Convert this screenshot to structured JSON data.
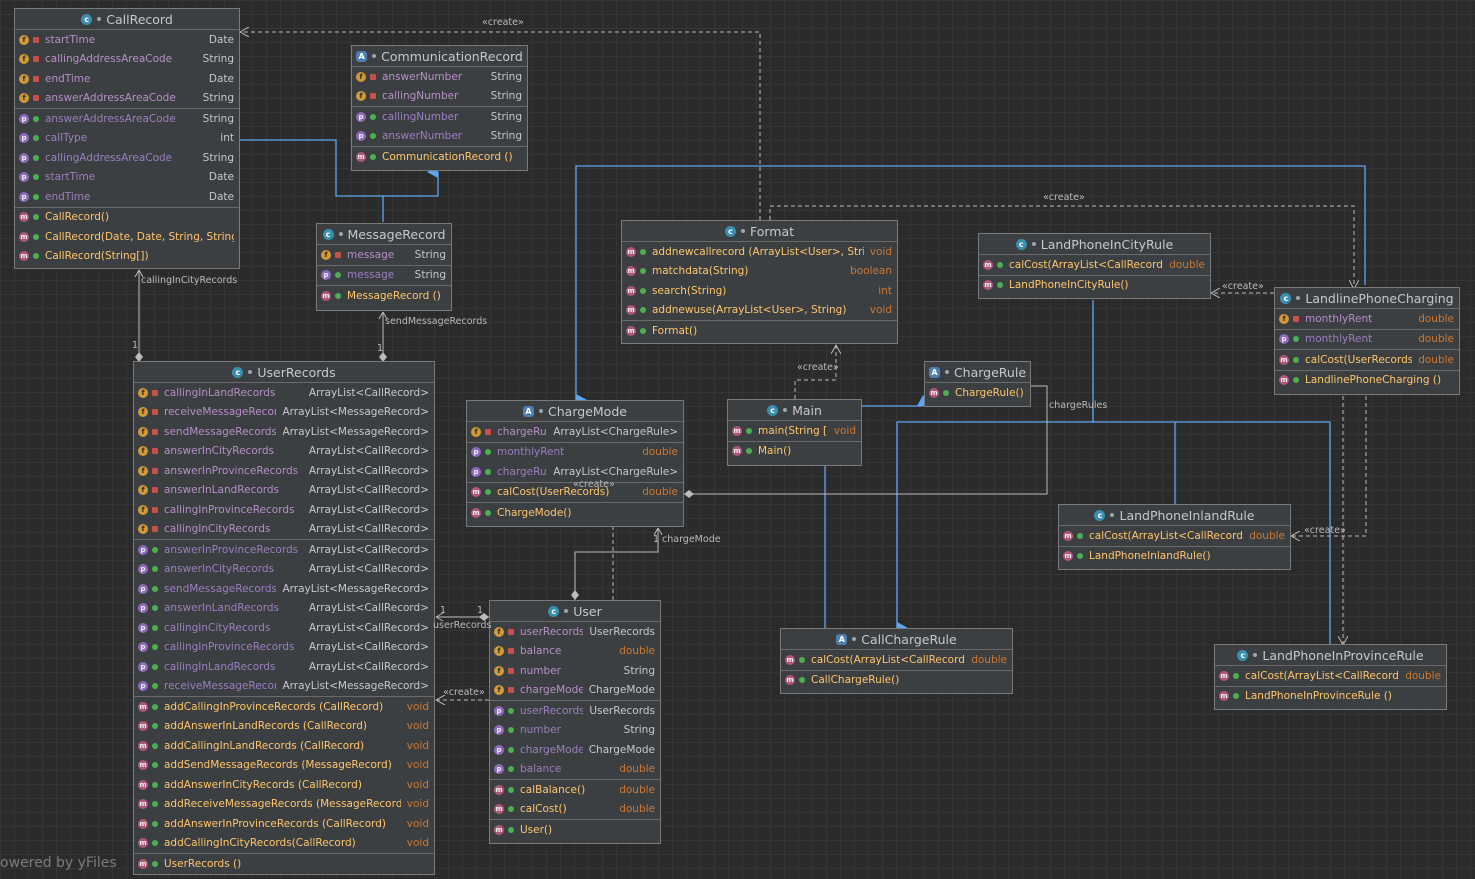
{
  "watermark": "owered by yFiles",
  "edge_labels": {
    "create": "«create»",
    "calling_in_city": "callingInCityRecords",
    "send_message": "sendMessageRecords",
    "charge_rules": "chargeRules",
    "charge_mode": "chargeMode",
    "user_records": "userRecords",
    "one": "1"
  },
  "colors": {
    "background": "#2b2b2b",
    "node_bg": "#3c3f41",
    "field_icon": "#d19a37",
    "property_icon": "#8d6bbb",
    "method_icon": "#b0567a",
    "method_name": "#ffc66d",
    "return_type": "#cc7832",
    "edge_blue": "#5fa4f0"
  },
  "classes": [
    {
      "id": "CallRecord",
      "name": "CallRecord",
      "kind": "class",
      "icon": "class-icon",
      "sections": [
        [
          {
            "k": "f",
            "v": "priv",
            "n": "startTime",
            "t": "Date"
          },
          {
            "k": "f",
            "v": "priv",
            "n": "callingAddressAreaCode",
            "t": "String"
          },
          {
            "k": "f",
            "v": "priv",
            "n": "endTime",
            "t": "Date"
          },
          {
            "k": "f",
            "v": "priv",
            "n": "answerAddressAreaCode",
            "t": "String"
          }
        ],
        [
          {
            "k": "p",
            "v": "pub",
            "n": "answerAddressAreaCode",
            "t": "String"
          },
          {
            "k": "p",
            "v": "pub",
            "n": "callType",
            "t": "int"
          },
          {
            "k": "p",
            "v": "pub",
            "n": "callingAddressAreaCode",
            "t": "String"
          },
          {
            "k": "p",
            "v": "pub",
            "n": "startTime",
            "t": "Date"
          },
          {
            "k": "p",
            "v": "pub",
            "n": "endTime",
            "t": "Date"
          }
        ],
        [
          {
            "k": "m",
            "v": "pub",
            "n": "CallRecord()",
            "t": ""
          },
          {
            "k": "m",
            "v": "pub",
            "n": "CallRecord(Date, Date, String, String)",
            "t": ""
          },
          {
            "k": "m",
            "v": "pub",
            "n": "CallRecord(String[])",
            "t": ""
          }
        ]
      ]
    },
    {
      "id": "CommunicationRecord",
      "name": "CommunicationRecord",
      "kind": "abstract",
      "icon": "abstract-class-icon",
      "sections": [
        [
          {
            "k": "f",
            "v": "priv",
            "n": "answerNumber",
            "t": "String"
          },
          {
            "k": "f",
            "v": "priv",
            "n": "callingNumber",
            "t": "String"
          }
        ],
        [
          {
            "k": "p",
            "v": "pub",
            "n": "callingNumber",
            "t": "String"
          },
          {
            "k": "p",
            "v": "pub",
            "n": "answerNumber",
            "t": "String"
          }
        ],
        [
          {
            "k": "m",
            "v": "pub",
            "n": "CommunicationRecord ()",
            "t": ""
          }
        ]
      ]
    },
    {
      "id": "MessageRecord",
      "name": "MessageRecord",
      "kind": "class",
      "icon": "class-icon",
      "sections": [
        [
          {
            "k": "f",
            "v": "priv",
            "n": "message",
            "t": "String"
          }
        ],
        [
          {
            "k": "p",
            "v": "pub",
            "n": "message",
            "t": "String"
          }
        ],
        [
          {
            "k": "m",
            "v": "pub",
            "n": "MessageRecord ()",
            "t": ""
          }
        ]
      ]
    },
    {
      "id": "Format",
      "name": "Format",
      "kind": "class",
      "icon": "class-icon",
      "sections": [
        [
          {
            "k": "m",
            "v": "pub",
            "n": "addnewcallrecord (ArrayList<User>, String)",
            "t": "void",
            "rt": true
          },
          {
            "k": "m",
            "v": "pub",
            "n": "matchdata(String)",
            "t": "boolean",
            "rt": true
          },
          {
            "k": "m",
            "v": "pub",
            "n": "search(String)",
            "t": "int",
            "rt": true
          },
          {
            "k": "m",
            "v": "pub",
            "n": "addnewuse(ArrayList<User>, String)",
            "t": "void",
            "rt": true
          }
        ],
        [
          {
            "k": "m",
            "v": "pub",
            "n": "Format()",
            "t": ""
          }
        ]
      ]
    },
    {
      "id": "LandPhoneInCityRule",
      "name": "LandPhoneInCityRule",
      "kind": "class",
      "icon": "class-icon",
      "sections": [
        [
          {
            "k": "m",
            "v": "pub",
            "n": "calCost(ArrayList<CallRecord>)",
            "t": "double",
            "rt": true
          }
        ],
        [
          {
            "k": "m",
            "v": "pub",
            "n": "LandPhoneInCityRule()",
            "t": ""
          }
        ]
      ]
    },
    {
      "id": "LandlinePhoneCharging",
      "name": "LandlinePhoneCharging",
      "kind": "class",
      "icon": "class-icon",
      "sections": [
        [
          {
            "k": "f",
            "v": "priv",
            "n": "monthlyRent",
            "t": "double",
            "rt": true
          }
        ],
        [
          {
            "k": "p",
            "v": "pub",
            "n": "monthlyRent",
            "t": "double",
            "rt": true
          }
        ],
        [
          {
            "k": "m",
            "v": "pub",
            "n": "calCost(UserRecords)",
            "t": "double",
            "rt": true
          }
        ],
        [
          {
            "k": "m",
            "v": "pub",
            "n": "LandlinePhoneCharging ()",
            "t": ""
          }
        ]
      ]
    },
    {
      "id": "ChargeRule",
      "name": "ChargeRule",
      "kind": "abstract",
      "icon": "abstract-class-icon",
      "sections": [
        [
          {
            "k": "m",
            "v": "pub",
            "n": "ChargeRule()",
            "t": ""
          }
        ]
      ]
    },
    {
      "id": "UserRecords",
      "name": "UserRecords",
      "kind": "class",
      "icon": "class-icon",
      "sections": [
        [
          {
            "k": "f",
            "v": "priv",
            "n": "callingInLandRecords",
            "t": "ArrayList<CallRecord>"
          },
          {
            "k": "f",
            "v": "priv",
            "n": "receiveMessageRecords",
            "t": "ArrayList<MessageRecord>"
          },
          {
            "k": "f",
            "v": "priv",
            "n": "sendMessageRecords",
            "t": "ArrayList<MessageRecord>"
          },
          {
            "k": "f",
            "v": "priv",
            "n": "answerInCityRecords",
            "t": "ArrayList<CallRecord>"
          },
          {
            "k": "f",
            "v": "priv",
            "n": "answerInProvinceRecords",
            "t": "ArrayList<CallRecord>"
          },
          {
            "k": "f",
            "v": "priv",
            "n": "answerInLandRecords",
            "t": "ArrayList<CallRecord>"
          },
          {
            "k": "f",
            "v": "priv",
            "n": "callingInProvinceRecords",
            "t": "ArrayList<CallRecord>"
          },
          {
            "k": "f",
            "v": "priv",
            "n": "callingInCityRecords",
            "t": "ArrayList<CallRecord>"
          }
        ],
        [
          {
            "k": "p",
            "v": "pub",
            "n": "answerInProvinceRecords",
            "t": "ArrayList<CallRecord>"
          },
          {
            "k": "p",
            "v": "pub",
            "n": "answerInCityRecords",
            "t": "ArrayList<CallRecord>"
          },
          {
            "k": "p",
            "v": "pub",
            "n": "sendMessageRecords",
            "t": "ArrayList<MessageRecord>"
          },
          {
            "k": "p",
            "v": "pub",
            "n": "answerInLandRecords",
            "t": "ArrayList<CallRecord>"
          },
          {
            "k": "p",
            "v": "pub",
            "n": "callingInCityRecords",
            "t": "ArrayList<CallRecord>"
          },
          {
            "k": "p",
            "v": "pub",
            "n": "callingInProvinceRecords",
            "t": "ArrayList<CallRecord>"
          },
          {
            "k": "p",
            "v": "pub",
            "n": "callingInLandRecords",
            "t": "ArrayList<CallRecord>"
          },
          {
            "k": "p",
            "v": "pub",
            "n": "receiveMessageRecords",
            "t": "ArrayList<MessageRecord>"
          }
        ],
        [
          {
            "k": "m",
            "v": "pub",
            "n": "addCallingInProvinceRecords (CallRecord)",
            "t": "void",
            "rt": true
          },
          {
            "k": "m",
            "v": "pub",
            "n": "addAnswerInLandRecords (CallRecord)",
            "t": "void",
            "rt": true
          },
          {
            "k": "m",
            "v": "pub",
            "n": "addCallingInLandRecords (CallRecord)",
            "t": "void",
            "rt": true
          },
          {
            "k": "m",
            "v": "pub",
            "n": "addSendMessageRecords (MessageRecord)",
            "t": "void",
            "rt": true
          },
          {
            "k": "m",
            "v": "pub",
            "n": "addAnswerInCityRecords (CallRecord)",
            "t": "void",
            "rt": true
          },
          {
            "k": "m",
            "v": "pub",
            "n": "addReceiveMessageRecords (MessageRecord)",
            "t": "void",
            "rt": true
          },
          {
            "k": "m",
            "v": "pub",
            "n": "addAnswerInProvinceRecords (CallRecord)",
            "t": "void",
            "rt": true
          },
          {
            "k": "m",
            "v": "pub",
            "n": "addCallingInCityRecords(CallRecord)",
            "t": "void",
            "rt": true
          }
        ],
        [
          {
            "k": "m",
            "v": "pub",
            "n": "UserRecords ()",
            "t": ""
          }
        ]
      ]
    },
    {
      "id": "ChargeMode",
      "name": "ChargeMode",
      "kind": "abstract",
      "icon": "abstract-class-icon",
      "sections": [
        [
          {
            "k": "f",
            "v": "priv",
            "n": "chargeRules",
            "t": "ArrayList<ChargeRule>"
          }
        ],
        [
          {
            "k": "p",
            "v": "pub",
            "n": "monthlyRent",
            "t": "double",
            "rt": true
          },
          {
            "k": "p",
            "v": "pub",
            "n": "chargeRules",
            "t": "ArrayList<ChargeRule>"
          }
        ],
        [
          {
            "k": "m",
            "v": "pub",
            "n": "calCost(UserRecords)",
            "t": "double",
            "rt": true
          }
        ],
        [
          {
            "k": "m",
            "v": "pub",
            "n": "ChargeMode()",
            "t": ""
          }
        ]
      ]
    },
    {
      "id": "Main",
      "name": "Main",
      "kind": "class",
      "icon": "main-class-icon",
      "sections": [
        [
          {
            "k": "m",
            "v": "pub",
            "n": "main(String [])",
            "t": "void",
            "rt": true
          }
        ],
        [
          {
            "k": "m",
            "v": "pub",
            "n": "Main()",
            "t": ""
          }
        ]
      ]
    },
    {
      "id": "LandPhoneInlandRule",
      "name": "LandPhoneInlandRule",
      "kind": "class",
      "icon": "class-icon",
      "sections": [
        [
          {
            "k": "m",
            "v": "pub",
            "n": "calCost(ArrayList<CallRecord>)",
            "t": "double",
            "rt": true
          }
        ],
        [
          {
            "k": "m",
            "v": "pub",
            "n": "LandPhoneInlandRule()",
            "t": ""
          }
        ]
      ]
    },
    {
      "id": "User",
      "name": "User",
      "kind": "class",
      "icon": "class-icon",
      "sections": [
        [
          {
            "k": "f",
            "v": "priv",
            "n": "userRecords",
            "t": "UserRecords"
          },
          {
            "k": "f",
            "v": "priv",
            "n": "balance",
            "t": "double",
            "rt": true
          },
          {
            "k": "f",
            "v": "priv",
            "n": "number",
            "t": "String"
          },
          {
            "k": "f",
            "v": "priv",
            "n": "chargeMode",
            "t": "ChargeMode"
          }
        ],
        [
          {
            "k": "p",
            "v": "pub",
            "n": "userRecords",
            "t": "UserRecords"
          },
          {
            "k": "p",
            "v": "pub",
            "n": "number",
            "t": "String"
          },
          {
            "k": "p",
            "v": "pub",
            "n": "chargeMode",
            "t": "ChargeMode"
          },
          {
            "k": "p",
            "v": "pub",
            "n": "balance",
            "t": "double",
            "rt": true
          }
        ],
        [
          {
            "k": "m",
            "v": "pub",
            "n": "calBalance()",
            "t": "double",
            "rt": true
          },
          {
            "k": "m",
            "v": "pub",
            "n": "calCost()",
            "t": "double",
            "rt": true
          }
        ],
        [
          {
            "k": "m",
            "v": "pub",
            "n": "User()",
            "t": ""
          }
        ]
      ]
    },
    {
      "id": "CallChargeRule",
      "name": "CallChargeRule",
      "kind": "abstract",
      "icon": "abstract-class-icon",
      "sections": [
        [
          {
            "k": "m",
            "v": "pub",
            "n": "calCost(ArrayList<CallRecord>)",
            "t": "double",
            "rt": true
          }
        ],
        [
          {
            "k": "m",
            "v": "pub",
            "n": "CallChargeRule()",
            "t": ""
          }
        ]
      ]
    },
    {
      "id": "LandPhoneInProvinceRule",
      "name": "LandPhoneInProvinceRule",
      "kind": "class",
      "icon": "class-icon",
      "sections": [
        [
          {
            "k": "m",
            "v": "pub",
            "n": "calCost(ArrayList<CallRecord>)",
            "t": "double",
            "rt": true
          }
        ],
        [
          {
            "k": "m",
            "v": "pub",
            "n": "LandPhoneInProvinceRule ()",
            "t": ""
          }
        ]
      ]
    }
  ]
}
